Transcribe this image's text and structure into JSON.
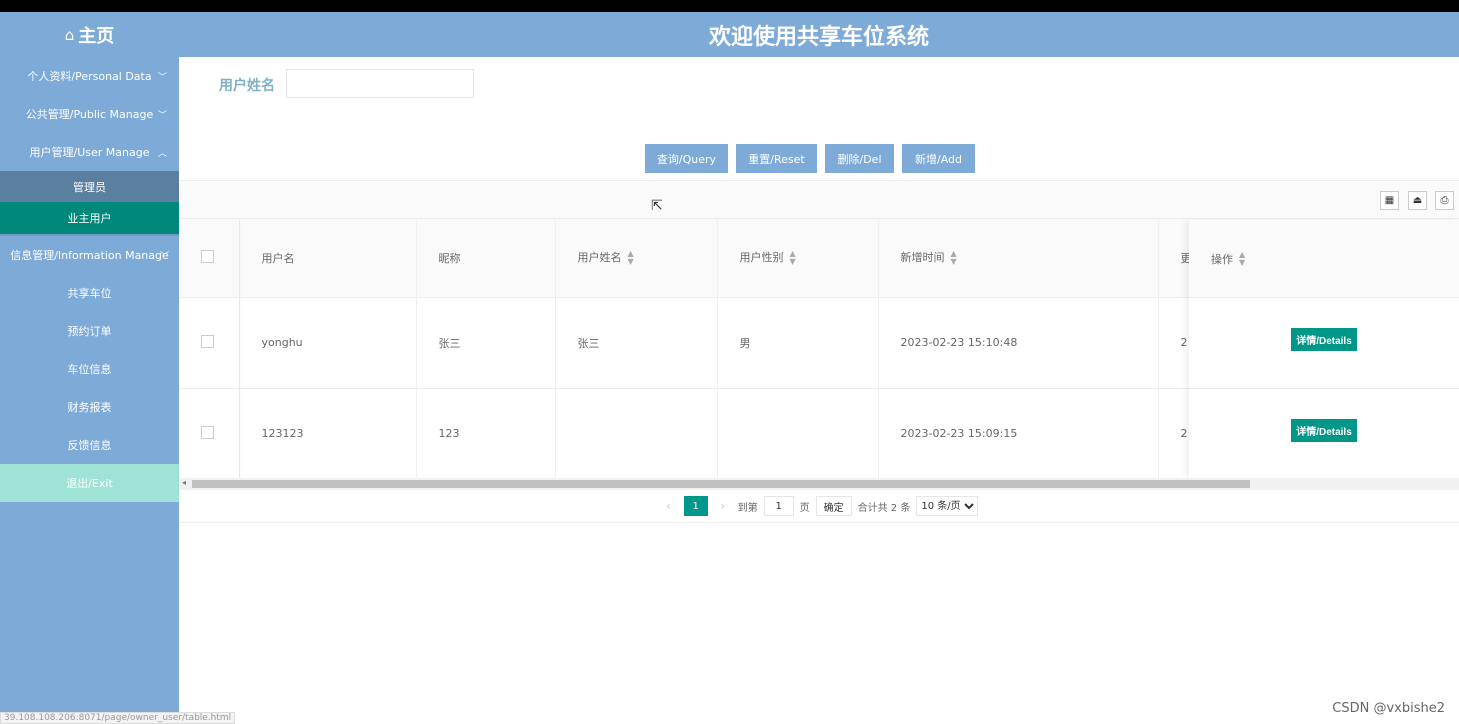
{
  "header": {
    "home_icon": "home-icon",
    "home_label": "主页",
    "title": "欢迎使用共享车位系统"
  },
  "sidebar": {
    "groups": [
      {
        "label": "个人资料/Personal Data",
        "chevron": "chevron-down-icon"
      },
      {
        "label": "公共管理/Public Manage",
        "chevron": "chevron-down-icon"
      },
      {
        "label": "用户管理/User Manage",
        "chevron": "chevron-up-icon",
        "subs": [
          "管理员",
          "业主用户"
        ],
        "active": "业主用户"
      },
      {
        "label": "信息管理/Information Manage",
        "chevron": "chevron-down-icon",
        "subs": [
          "共享车位",
          "预约订单",
          "车位信息",
          "财务报表",
          "反馈信息"
        ]
      }
    ],
    "exit_label": "退出/Exit"
  },
  "search": {
    "label": "用户姓名",
    "value": ""
  },
  "buttons": {
    "query": "查询/Query",
    "reset": "重置/Reset",
    "delete": "删除/Del",
    "add": "新增/Add"
  },
  "toolbar": {
    "icons": [
      "columns-icon",
      "export-icon",
      "print-icon"
    ]
  },
  "table": {
    "columns": [
      "用户名",
      "昵称",
      "用户姓名",
      "用户性别",
      "新增时间",
      "更",
      "操作"
    ],
    "rows": [
      {
        "username": "yonghu",
        "nickname": "张三",
        "realname": "张三",
        "gender": "男",
        "created": "2023-02-23 15:10:48",
        "more": "2",
        "action": "详情/Details"
      },
      {
        "username": "123123",
        "nickname": "123",
        "realname": "",
        "gender": "",
        "created": "2023-02-23 15:09:15",
        "more": "2",
        "action": "详情/Details"
      }
    ]
  },
  "pager": {
    "current_page": "1",
    "goto_label": "到第",
    "goto_value": "1",
    "page_unit": "页",
    "confirm": "确定",
    "total": "合计共 2 条",
    "page_size": "10 条/页"
  },
  "status_url": "39.108.108.206:8071/page/owner_user/table.html",
  "watermark": "CSDN @vxbishe2"
}
